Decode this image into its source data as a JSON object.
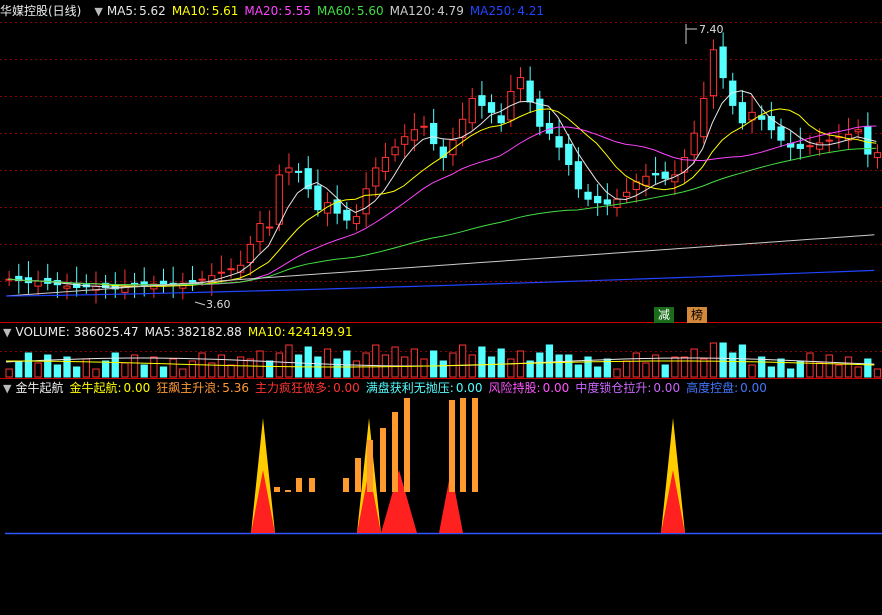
{
  "main": {
    "title": "华媒控股(日线)",
    "indicators": [
      {
        "label": "MA5:",
        "value": "5.62",
        "color": "#e6e6e6"
      },
      {
        "label": "MA10:",
        "value": "5.61",
        "color": "#ffff00"
      },
      {
        "label": "MA20:",
        "value": "5.55",
        "color": "#ff44ff"
      },
      {
        "label": "MA60:",
        "value": "5.60",
        "color": "#44dd44"
      },
      {
        "label": "MA120:",
        "value": "4.79",
        "color": "#cccccc"
      },
      {
        "label": "MA250:",
        "value": "4.21",
        "color": "#2244ff"
      }
    ],
    "high_label": "7.40",
    "low_label": "3.60",
    "badges": [
      {
        "text": "减",
        "color": "#ffffff",
        "bg": "#1a6b1a"
      },
      {
        "text": "榜",
        "color": "#000000",
        "bg": "#d4883a"
      }
    ]
  },
  "volume": {
    "title": "VOLUME:",
    "value": "386025.47",
    "ma5_label": "MA5:",
    "ma5_value": "382182.88",
    "ma10_label": "MA10:",
    "ma10_value": "424149.91"
  },
  "indicator_pane": {
    "title": "金牛起航",
    "items": [
      {
        "label": "金牛起航:",
        "value": "0.00",
        "color": "#ffff00"
      },
      {
        "label": "狂飙主升浪:",
        "value": "5.36",
        "color": "#ff9933"
      },
      {
        "label": "主力疯狂做多:",
        "value": "0.00",
        "color": "#ff3333"
      },
      {
        "label": "满盘获利无抛压:",
        "value": "0.00",
        "color": "#55ffff"
      },
      {
        "label": "风险持股:",
        "value": "0.00",
        "color": "#ff55ff"
      },
      {
        "label": "中度锁仓拉升:",
        "value": "0.00",
        "color": "#cc66ff"
      },
      {
        "label": "高度控盘:",
        "value": "0.00",
        "color": "#4477ff"
      }
    ]
  },
  "colors": {
    "up": "#ff3232",
    "down": "#54ffff",
    "grid": "#8b0000",
    "sep": "#c00000"
  }
}
